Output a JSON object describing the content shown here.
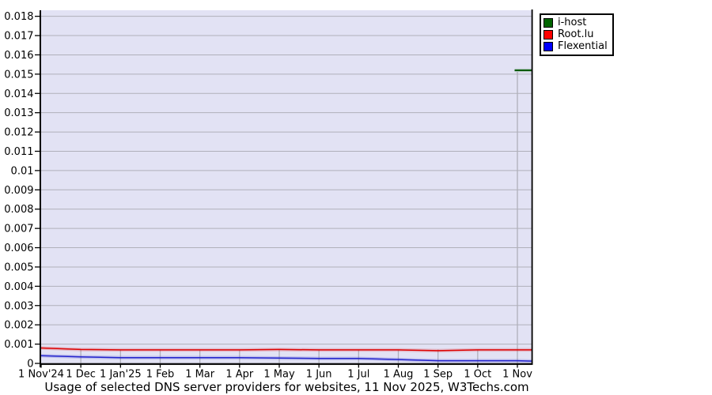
{
  "chart_data": {
    "type": "line",
    "title": "Usage of selected DNS server providers for websites, 11 Nov 2025, W3Techs.com",
    "xlabel": "",
    "ylabel": "",
    "ylim": [
      0,
      0.018
    ],
    "y_step": 0.001,
    "y_tick_labels": [
      "0.018",
      "0.017",
      "0.016",
      "0.015",
      "0.014",
      "0.013",
      "0.012",
      "0.011",
      "0.01",
      "0.009",
      "0.008",
      "0.007",
      "0.006",
      "0.005",
      "0.004",
      "0.003",
      "0.002",
      "0.001",
      "0"
    ],
    "x_tick_labels": [
      "1 Nov'24",
      "1 Dec",
      "1 Jan'25",
      "1 Feb",
      "1 Mar",
      "1 Apr",
      "1 May",
      "1 Jun",
      "1 Jul",
      "1 Aug",
      "1 Sep",
      "1 Oct",
      "1 Nov"
    ],
    "x_range_note": "monthly points from 1 Nov 2024 to 1 Nov 2025, lines extend to 11 Nov 2025 at the right edge",
    "grid": "horizontal gridlines at every 0.001; vertical month gridlines visible only below the topmost series",
    "legend_position": "outside plot, top-right",
    "series": [
      {
        "name": "i-host",
        "legend_color": "#006400",
        "line_color": "#005a00",
        "x_month": [
          11.93,
          12.37
        ],
        "values": [
          0.0152,
          0.0152
        ],
        "note": "appears only at ~1 Nov 2025 at 0.0152"
      },
      {
        "name": "Root.lu",
        "legend_color": "#ff0000",
        "line_color": "#dd0000",
        "x_month": [
          0,
          1,
          2,
          3,
          4,
          5,
          6,
          7,
          8,
          9,
          10,
          11,
          12,
          12.37
        ],
        "values": [
          0.0008,
          0.00072,
          0.0007,
          0.0007,
          0.0007,
          0.0007,
          0.00072,
          0.0007,
          0.0007,
          0.0007,
          0.00066,
          0.0007,
          0.0007,
          0.0007
        ]
      },
      {
        "name": "Flexential",
        "legend_color": "#0000ff",
        "line_color": "#2222cc",
        "x_month": [
          0,
          1,
          2,
          3,
          4,
          5,
          6,
          7,
          8,
          9,
          10,
          11,
          12,
          12.37
        ],
        "values": [
          0.0004,
          0.00034,
          0.0003,
          0.0003,
          0.0003,
          0.0003,
          0.00028,
          0.00026,
          0.00026,
          0.0002,
          0.00014,
          0.00014,
          0.00014,
          0.00012
        ]
      }
    ]
  },
  "legend": {
    "items": [
      {
        "label": "i-host",
        "color": "#006400"
      },
      {
        "label": "Root.lu",
        "color": "#ff0000"
      },
      {
        "label": "Flexential",
        "color": "#0000ff"
      }
    ]
  },
  "colors": {
    "page_bg": "#ffffff",
    "plot_bg": "#e2e2f4",
    "gridline": "#b0b0ba",
    "axis": "#000000",
    "text": "#000000"
  }
}
